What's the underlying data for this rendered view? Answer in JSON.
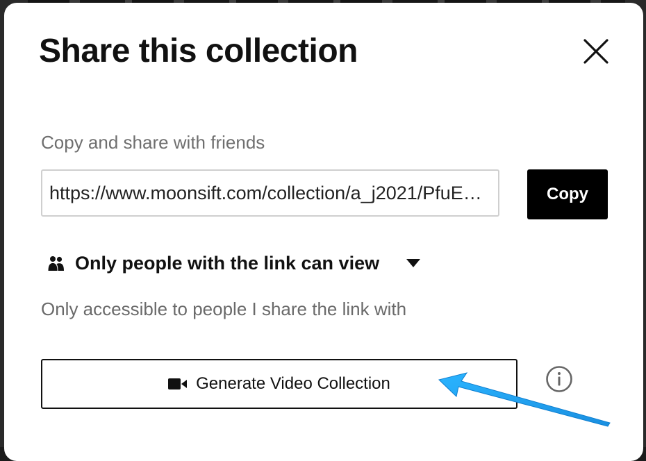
{
  "modal": {
    "title": "Share this collection",
    "subtitle": "Copy and share with friends",
    "link_value": "https://www.moonsift.com/collection/a_j2021/PfuE…",
    "copy_label": "Copy",
    "visibility_label": "Only people with the link can view",
    "visibility_description": "Only accessible to people I share the link with",
    "generate_label": "Generate Video Collection"
  },
  "icons": {
    "close": "close-icon",
    "people": "people-icon",
    "caret": "caret-down-icon",
    "camera": "video-camera-icon",
    "info": "info-icon"
  },
  "colors": {
    "primary_button": "#000000",
    "annotation_arrow": "#1aa0f0",
    "muted_text": "#6f6f6f"
  }
}
